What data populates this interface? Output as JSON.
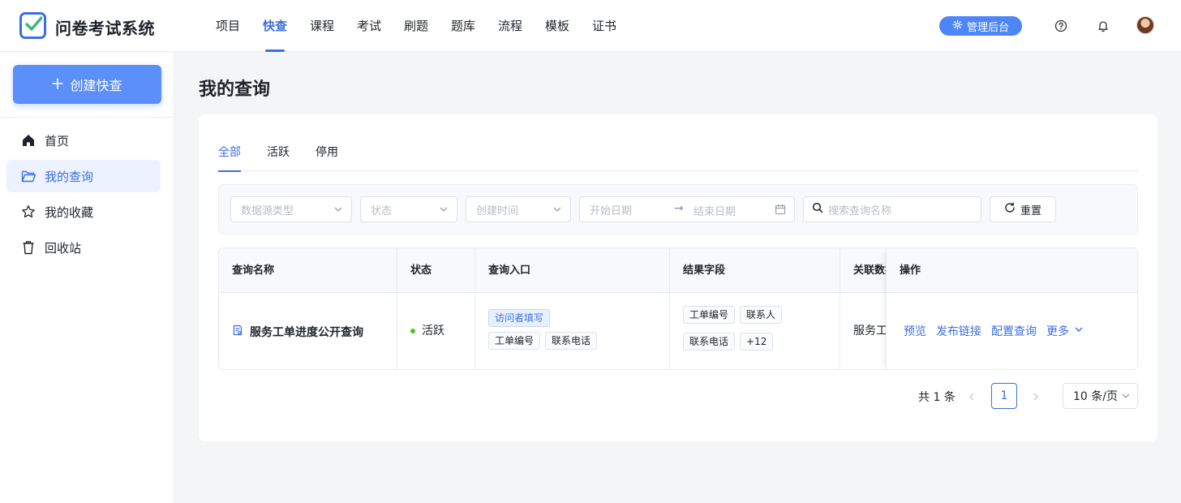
{
  "app": {
    "title": "问卷考试系统"
  },
  "nav": {
    "items": [
      "项目",
      "快查",
      "课程",
      "考试",
      "刷题",
      "题库",
      "流程",
      "模板",
      "证书"
    ],
    "active_index": 1
  },
  "header": {
    "admin_label": "管理后台"
  },
  "sidebar": {
    "create_label": "创建快查",
    "items": [
      {
        "label": "首页",
        "icon": "home-icon"
      },
      {
        "label": "我的查询",
        "icon": "folder-open-icon",
        "active": true
      },
      {
        "label": "我的收藏",
        "icon": "star-icon"
      },
      {
        "label": "回收站",
        "icon": "trash-icon"
      }
    ]
  },
  "page": {
    "title": "我的查询"
  },
  "tabs": [
    "全部",
    "活跃",
    "停用"
  ],
  "filters": {
    "datasource_placeholder": "数据源类型",
    "status_placeholder": "状态",
    "created_placeholder": "创建时间",
    "start_date_placeholder": "开始日期",
    "end_date_placeholder": "结束日期",
    "search_placeholder": "搜索查询名称",
    "reset_label": "重置"
  },
  "table": {
    "columns": [
      "查询名称",
      "状态",
      "查询入口",
      "结果字段",
      "关联数据",
      "操作"
    ],
    "rows": [
      {
        "name": "服务工单进度公开查询",
        "status": "活跃",
        "entry_tag": "访问者填写",
        "entry_fields": [
          "工单编号",
          "联系电话"
        ],
        "result_fields": [
          "工单编号",
          "联系人",
          "联系电话",
          "+12"
        ],
        "related": "服务工单",
        "actions": [
          "预览",
          "发布链接",
          "配置查询",
          "更多"
        ]
      }
    ]
  },
  "pagination": {
    "total_text": "共 1 条",
    "current_page": "1",
    "page_size": "10 条/页"
  },
  "colors": {
    "primary": "#3c6fe0",
    "button": "#5b8ff9",
    "active_dot": "#52c41a"
  }
}
